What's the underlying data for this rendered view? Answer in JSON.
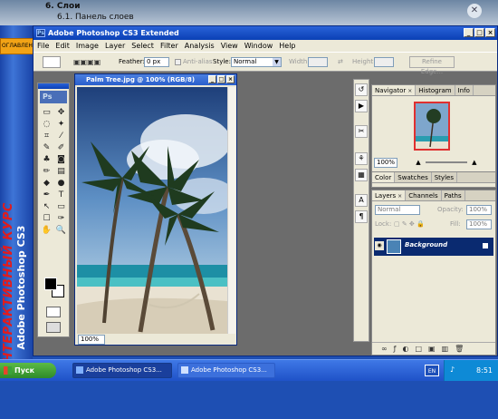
{
  "course": {
    "title": "6. Слои",
    "subtitle": "6.1. Панель слоев",
    "close_icon": "close-icon",
    "contents_tab": "ОГЛАВЛЕНИЕ",
    "vertical_title": "ИНТЕРАКТИВНЫЙ КУРС",
    "vertical_subtitle": "Adobe Photoshop CS3"
  },
  "app": {
    "title": "Adobe Photoshop CS3 Extended",
    "window_buttons": [
      "_",
      "□",
      "×"
    ],
    "menu": [
      "File",
      "Edit",
      "Image",
      "Layer",
      "Select",
      "Filter",
      "Analysis",
      "View",
      "Window",
      "Help"
    ]
  },
  "options": {
    "feather_label": "Feather:",
    "feather_value": "0 px",
    "antialias_label": "Anti-alias",
    "style_label": "Style:",
    "style_value": "Normal",
    "width_label": "Width:",
    "height_label": "Height:",
    "refine_label": "Refine Edge..."
  },
  "toolbox": {
    "logo": "Ps",
    "tools": [
      "▭",
      "✥",
      "◌",
      "✦",
      "⌗",
      "⁄",
      "✎",
      "✐",
      "♣",
      "◙",
      "✏",
      "▤",
      "◆",
      "●",
      "✒",
      "T",
      "↖",
      "▭",
      "☐",
      "✑",
      "✋",
      "🔍"
    ]
  },
  "document": {
    "title": "Palm Tree.jpg @ 100% (RGB/8)",
    "zoom": "100%"
  },
  "navigator": {
    "tabs": [
      "Navigator",
      "Histogram",
      "Info"
    ],
    "zoom": "100%"
  },
  "color_panel": {
    "tabs": [
      "Color",
      "Swatches",
      "Styles"
    ]
  },
  "layers_panel": {
    "tabs": [
      "Layers",
      "Channels",
      "Paths"
    ],
    "blend_mode": "Normal",
    "opacity_label": "Opacity:",
    "opacity_value": "100%",
    "lock_label": "Lock:",
    "fill_label": "Fill:",
    "fill_value": "100%",
    "layer_name": "Background",
    "footer_icons": [
      "∞",
      "ƒ",
      "◐",
      "□",
      "▣",
      "▥",
      "🗑"
    ]
  },
  "taskbar": {
    "start_label": "Пуск",
    "app_label": "Adobe Photoshop CS3...",
    "app2_label": "Adobe Photoshop CS3...",
    "language": "EN",
    "clock": "8:51"
  }
}
